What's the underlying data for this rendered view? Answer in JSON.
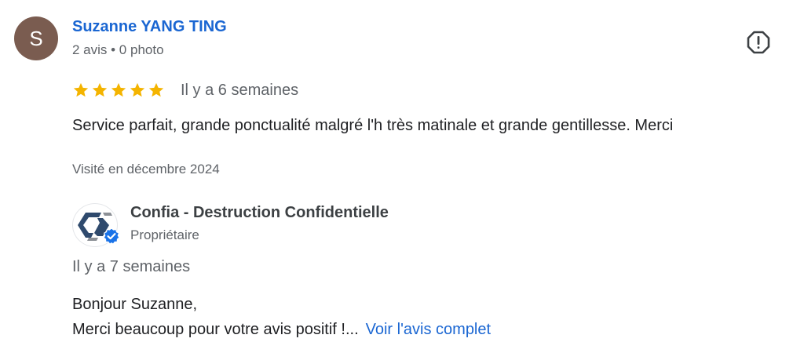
{
  "review": {
    "author": {
      "initial": "S",
      "avatar_color": "#7a5c50",
      "name": "Suzanne YANG TING",
      "meta": "2 avis • 0 photo"
    },
    "rating": 5,
    "rating_max": 5,
    "star_color": "#f4b400",
    "date": "Il y a 6 semaines",
    "text": "Service parfait, grande ponctualité malgré l'h très matinale et grande gentillesse. Merci",
    "visited": "Visité en décembre 2024",
    "report_icon": "report-flag-icon"
  },
  "owner_reply": {
    "business_name": "Confia - Destruction Confidentielle",
    "role": "Propriétaire",
    "verified_icon": "verified-badge-icon",
    "date": "Il y a 7 semaines",
    "greeting": "Bonjour Suzanne,",
    "excerpt": "Merci beaucoup pour votre avis positif !...",
    "read_more": "Voir l'avis complet"
  },
  "colors": {
    "link": "#1a66d2",
    "secondary_text": "#5f6368",
    "primary_text": "#202124",
    "verified": "#1a73e8"
  }
}
